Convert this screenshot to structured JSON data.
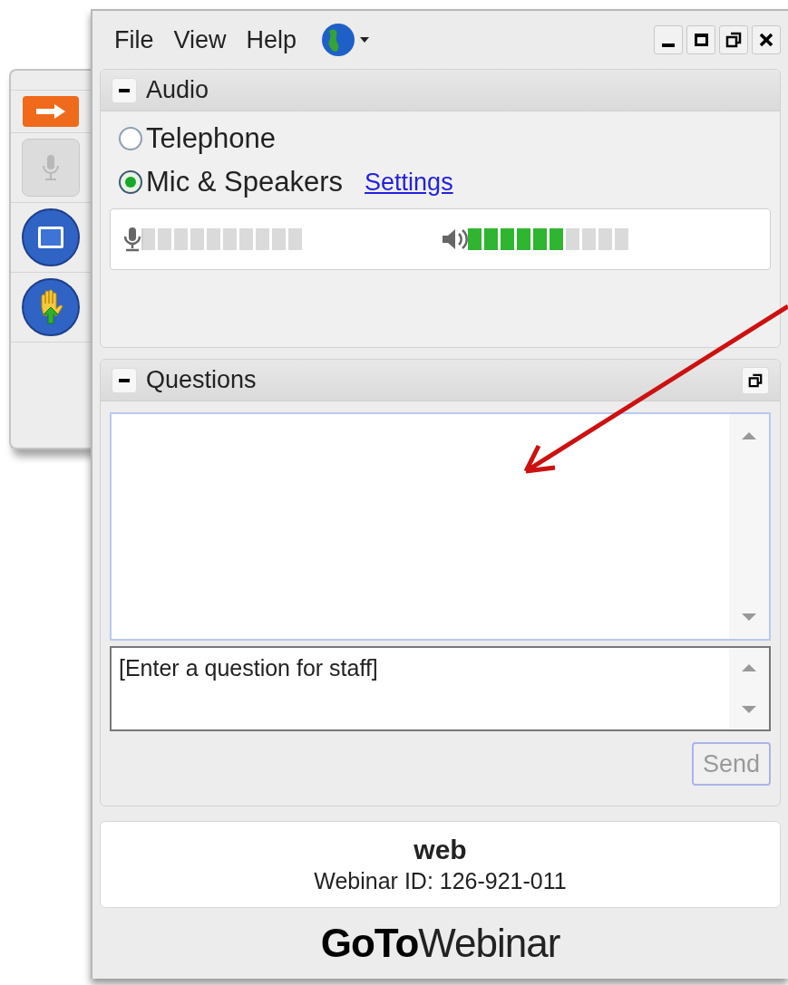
{
  "menu": [
    {
      "label": "File"
    },
    {
      "label": "View"
    },
    {
      "label": "Help"
    }
  ],
  "toolbar": [
    {
      "kind": "arrow",
      "disabled": false
    },
    {
      "kind": "mic",
      "disabled": true
    },
    {
      "kind": "screen",
      "disabled": false
    },
    {
      "kind": "hand",
      "disabled": false
    }
  ],
  "audio": {
    "title": "Audio",
    "expanded": true,
    "options": [
      {
        "label": "Telephone",
        "selected": false
      },
      {
        "label": "Mic & Speakers",
        "selected": true
      }
    ],
    "settings_link": "Settings",
    "mic_meter": {
      "level": 0
    },
    "speaker_meter": {
      "level": 0.6
    }
  },
  "questions": {
    "title": "Questions",
    "expanded": true,
    "input": {
      "placeholder": "[Enter a question for staff]"
    },
    "send_button": {
      "label": "Send",
      "disabled": true
    }
  },
  "info": {
    "name": "web",
    "webinar_id": "Webinar ID: 126-921-011"
  },
  "logo": "**GoTo**Webinar"
}
